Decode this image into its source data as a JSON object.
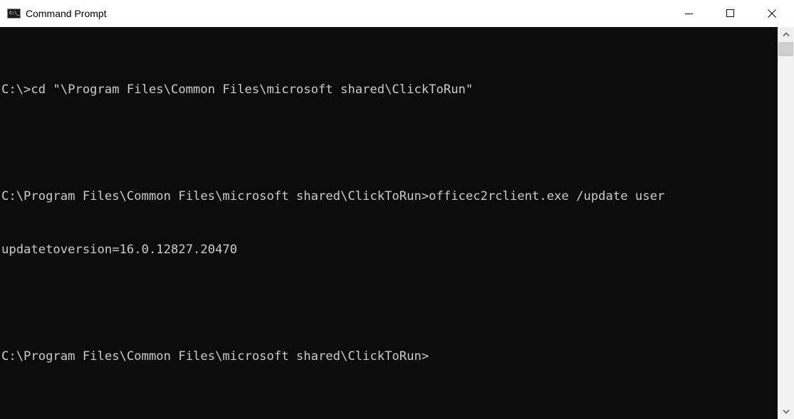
{
  "window": {
    "title": "Command Prompt",
    "icon": "cmd-icon",
    "icon_text": "C:\\_",
    "controls": [
      "minimize-icon",
      "maximize-icon",
      "close-icon"
    ]
  },
  "console": {
    "background": "#0c0c0c",
    "foreground": "#cccccc",
    "lines": [
      "C:\\>cd \"\\Program Files\\Common Files\\microsoft shared\\ClickToRun\"",
      "",
      "C:\\Program Files\\Common Files\\microsoft shared\\ClickToRun>officec2rclient.exe /update user",
      "updatetoversion=16.0.12827.20470",
      "",
      "C:\\Program Files\\Common Files\\microsoft shared\\ClickToRun>"
    ]
  },
  "scrollbar": {
    "up": "chevron-up-icon",
    "down": "chevron-down-icon"
  }
}
